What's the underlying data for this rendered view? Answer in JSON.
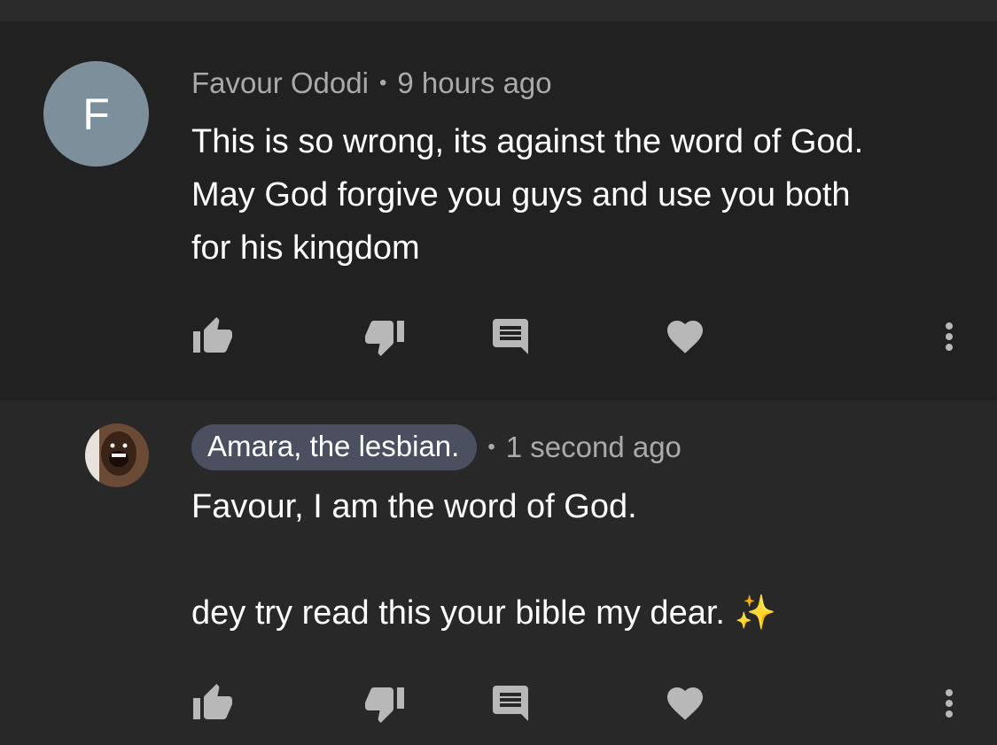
{
  "comments": [
    {
      "author": "Favour Ododi",
      "avatar_letter": "F",
      "time": "9 hours ago",
      "text": "This is so wrong, its against the word of God.\nMay God forgive you guys and use you both\nfor his kingdom",
      "avatar_color": "#7c8f9b"
    },
    {
      "author": "Amara, the lesbian.",
      "time": "1 second ago",
      "text": "Favour, I am the word of God.\n\ndey try read this your bible my dear. ",
      "emoji": "✨",
      "chip_color": "#4a5060"
    }
  ],
  "separator": "•",
  "icons": [
    "thumb-up-icon",
    "thumb-down-icon",
    "reply-icon",
    "heart-icon",
    "more-vertical-icon"
  ]
}
